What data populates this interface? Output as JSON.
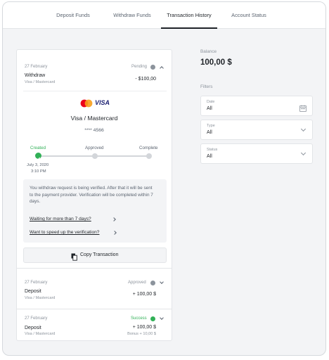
{
  "tabs": [
    "Deposit Funds",
    "Withdraw Funds",
    "Transaction History",
    "Account Status"
  ],
  "active_tab": 2,
  "transactions": [
    {
      "date": "27 February",
      "status": "Pending",
      "status_color": "#8c939c",
      "title": "Withdraw",
      "method": "Visa / Mastercard",
      "amount": "- $100,00"
    },
    {
      "date": "27 February",
      "status": "Approved",
      "status_color": "#8c939c",
      "title": "Deposit",
      "method": "Visa / Mastercard",
      "amount": "+ 100,00 $"
    },
    {
      "date": "27 February",
      "status": "Success",
      "status_color": "#31b057",
      "title": "Deposit",
      "method": "Visa / Mastercard",
      "amount": "+ 100,00 $",
      "bonus": "Bonus + 10,00 $"
    }
  ],
  "details": {
    "card_brand": "VISA",
    "card_name": "Visa / Mastercard",
    "card_number": "**** 4566",
    "steps": [
      {
        "label": "Created",
        "done": true
      },
      {
        "label": "Approved",
        "done": false
      },
      {
        "label": "Complete",
        "done": false
      }
    ],
    "created_date": "July 3, 2020",
    "created_time": "3:10 PM",
    "info_text": "You withdraw request is being verified. After that it will be sent to the payment provider. Verification will be completed within 7 days.",
    "link_wait": "Waiting for more than 7 days?",
    "link_speed": "Want to speed up the verification?",
    "copy_label": "Copy Transaction"
  },
  "balance": {
    "label": "Balance",
    "value": "100,00 $"
  },
  "filters": {
    "label": "Filters",
    "date": {
      "label": "Date",
      "value": "All"
    },
    "type": {
      "label": "Type",
      "value": "All"
    },
    "status": {
      "label": "Status",
      "value": "All"
    }
  },
  "colors": {
    "accent_green": "#31b057",
    "step_grey": "#d3d6da",
    "mastercard_red": "#eb001b",
    "mastercard_orange": "#f79e1b",
    "visa_blue": "#1a1f71"
  }
}
